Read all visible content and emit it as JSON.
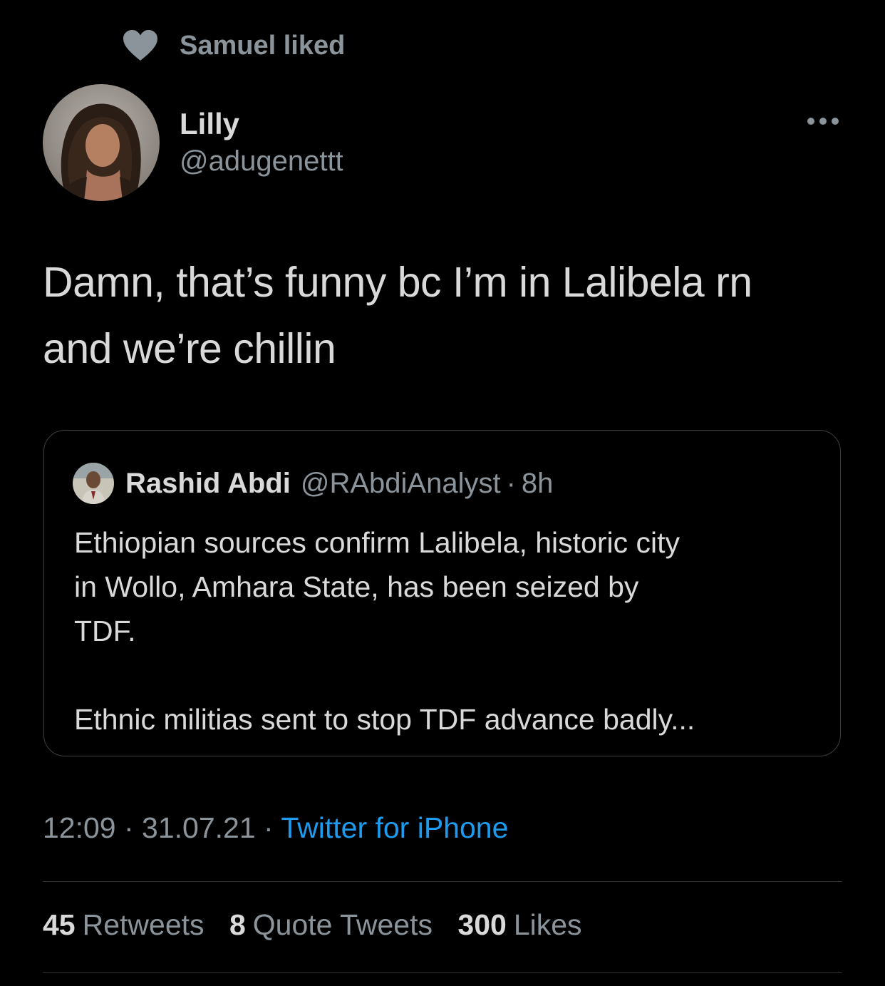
{
  "social_context": {
    "text": "Samuel liked",
    "icon": "heart-icon"
  },
  "author": {
    "display_name": "Lilly",
    "handle": "@adugenettt"
  },
  "tweet": {
    "line1": "Damn, that’s funny bc I’m in Lalibela rn",
    "line2": "and we’re chillin"
  },
  "quote": {
    "display_name": "Rashid Abdi",
    "handle": "@RAbdiAnalyst",
    "separator": "·",
    "time": "8h",
    "lines": [
      "Ethiopian sources confirm Lalibela, historic city",
      "in Wollo, Amhara State, has been seized by",
      "TDF."
    ],
    "paragraph2": "Ethnic militias sent to stop TDF advance badly..."
  },
  "meta": {
    "time": "12:09",
    "sep1": " · ",
    "date": "31.07.21",
    "sep2": " · ",
    "source": "Twitter for iPhone"
  },
  "stats": {
    "retweets_count": "45",
    "retweets_label": "Retweets",
    "quotes_count": "8",
    "quotes_label": "Quote Tweets",
    "likes_count": "300",
    "likes_label": "Likes"
  },
  "colors": {
    "background": "#000000",
    "text": "#d9d9d9",
    "secondary": "#8b949b",
    "link": "#1d9bf0",
    "border": "#3a3f44"
  }
}
